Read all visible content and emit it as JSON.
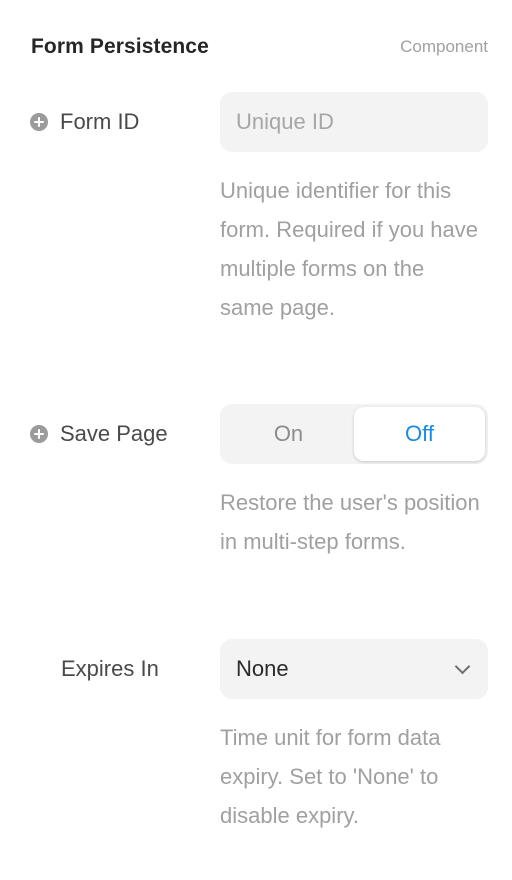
{
  "header": {
    "title": "Form Persistence",
    "subtitle": "Component"
  },
  "fields": {
    "form_id": {
      "label": "Form ID",
      "icon": "plus-circle-icon",
      "placeholder": "Unique ID",
      "value": "",
      "help": "Unique identifier for this form. Required if you have multiple forms on the same page."
    },
    "save_page": {
      "label": "Save Page",
      "icon": "plus-circle-icon",
      "options": [
        "On",
        "Off"
      ],
      "selected": "Off",
      "help": "Restore the user's position in multi-step forms."
    },
    "expires_in": {
      "label": "Expires In",
      "selected": "None",
      "help": "Time unit for form data expiry. Set to 'None' to disable expiry."
    }
  },
  "colors": {
    "accent": "#1a8be6",
    "control_bg": "#f3f3f3",
    "help_text": "#a0a0a0"
  }
}
